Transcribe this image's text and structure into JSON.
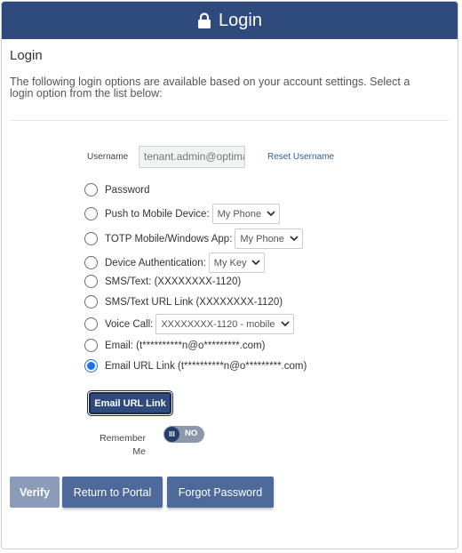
{
  "header": {
    "title": "Login",
    "icon": "lock-icon"
  },
  "section_title": "Login",
  "intro": "The following login options are available based on your account settings. Select a login option from the list below:",
  "username": {
    "label": "Username",
    "value": "tenant.admin@optimal",
    "reset_link": "Reset Username"
  },
  "options": [
    {
      "label": "Password",
      "checked": false
    },
    {
      "label": "Push to Mobile Device:",
      "select": "My Phone",
      "checked": false
    },
    {
      "label": "TOTP Mobile/Windows App:",
      "select": "My Phone",
      "checked": false
    },
    {
      "label": "Device Authentication:",
      "select": "My Key",
      "checked": false
    },
    {
      "label": "SMS/Text: (XXXXXXXX-1120)",
      "checked": false
    },
    {
      "label": "SMS/Text URL Link (XXXXXXXX-1120)",
      "checked": false
    },
    {
      "label": "Voice Call:",
      "select": "XXXXXXXX-1120 - mobile",
      "checked": false
    },
    {
      "label": "Email: (t**********n@o*********.com)",
      "checked": false
    },
    {
      "label": "Email URL Link (t**********n@o*********.com)",
      "checked": true
    }
  ],
  "email_button": "Email URL Link",
  "remember": {
    "label": "Remember Me",
    "knob": "III",
    "state": "NO"
  },
  "buttons": {
    "verify": "Verify",
    "portal": "Return to Portal",
    "forgot": "Forgot Password"
  },
  "colors": {
    "header": "#2f4a7c",
    "button": "#4e6a9a",
    "verify_disabled": "#8a9cb8",
    "link": "#2f5a9c",
    "radio_checked": "#1a73e8"
  }
}
